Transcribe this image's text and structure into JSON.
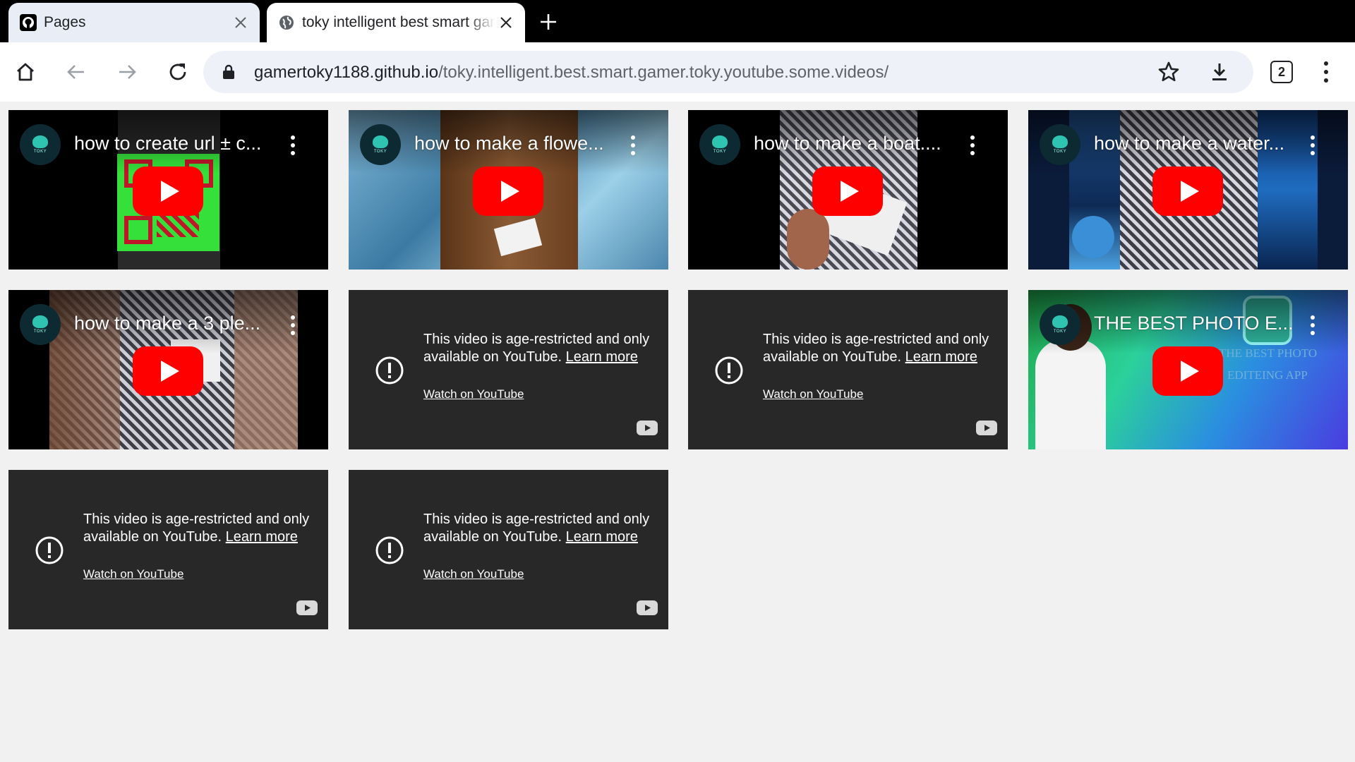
{
  "browser": {
    "tabs": [
      {
        "title": "Pages",
        "favicon": "github-icon",
        "active": false
      },
      {
        "title": "toky intelligent best smart gamer toky youtube some videos",
        "favicon": "globe-icon",
        "active": true
      }
    ],
    "url_host": "gamertoky1188.github.io",
    "url_path": "/toky.intelligent.best.smart.gamer.toky.youtube.some.videos/",
    "tab_count": "2"
  },
  "videos": [
    {
      "title": "how to create url ± c...",
      "type": "playable",
      "thumb": "qr"
    },
    {
      "title": "how to make a flowe...",
      "type": "playable",
      "thumb": "water"
    },
    {
      "title": "how to make a boat....",
      "type": "playable",
      "thumb": "mesh"
    },
    {
      "title": "how to make a water...",
      "type": "playable",
      "thumb": "blue"
    },
    {
      "title": "how to make a 3 ple...",
      "type": "playable",
      "thumb": "hands"
    },
    {
      "type": "restricted"
    },
    {
      "type": "restricted"
    },
    {
      "title": "THE BEST PHOTO E...",
      "type": "playable",
      "thumb": "green",
      "overlay_line1": "THE BEST PHOTO",
      "overlay_line2": "EDITEING APP"
    },
    {
      "type": "restricted"
    },
    {
      "type": "restricted"
    }
  ],
  "restricted_text": {
    "message": "This video is age-restricted and only available on YouTube.",
    "learn_more": "Learn more",
    "watch_link": "Watch on YouTube"
  },
  "channel_avatar_text": "TOKY",
  "colors": {
    "youtube_red": "#ff0000",
    "restricted_bg": "#282828",
    "omnibox_bg": "#eef2f8"
  }
}
